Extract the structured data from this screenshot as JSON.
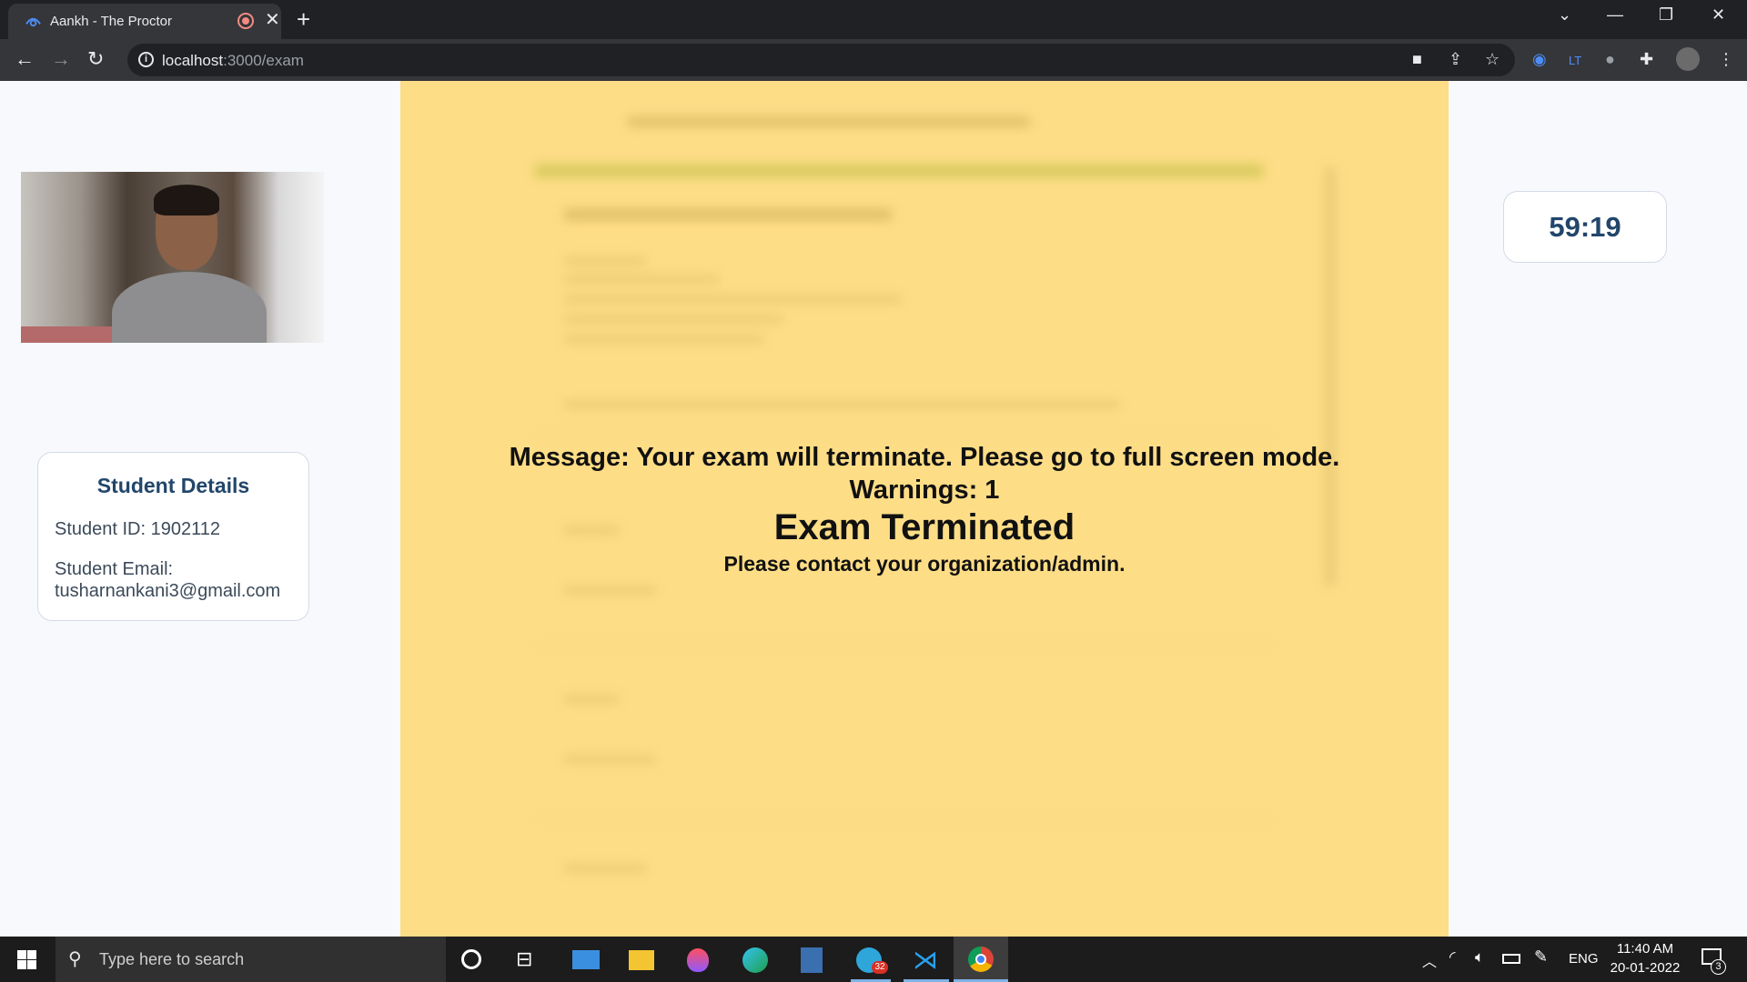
{
  "browser": {
    "tab_title": "Aankh - The Proctor",
    "tab_close": "✕",
    "new_tab": "+",
    "url_host": "localhost",
    "url_path": ":3000/exam",
    "window_controls": {
      "list": "⌄",
      "minimize": "—",
      "restore": "❐",
      "close": "✕"
    }
  },
  "page": {
    "student_details": {
      "heading": "Student Details",
      "id_line": "Student ID: 1902112",
      "email_label": "Student Email:",
      "email_value": "tusharnankani3@gmail.com"
    },
    "timer": "59:19",
    "overlay": {
      "message": "Message: Your exam will terminate. Please go to full screen mode.",
      "warnings": "Warnings: 1",
      "status": "Exam Terminated",
      "contact": "Please contact your organization/admin."
    }
  },
  "taskbar": {
    "search_placeholder": "Type here to search",
    "telegram_badge": "32",
    "lang": "ENG",
    "time": "11:40 AM",
    "date": "20-01-2022",
    "notification_count": "3"
  },
  "colors": {
    "overlay_bg": "#fddd86",
    "accent": "#22466b",
    "chrome_dark": "#202124"
  }
}
